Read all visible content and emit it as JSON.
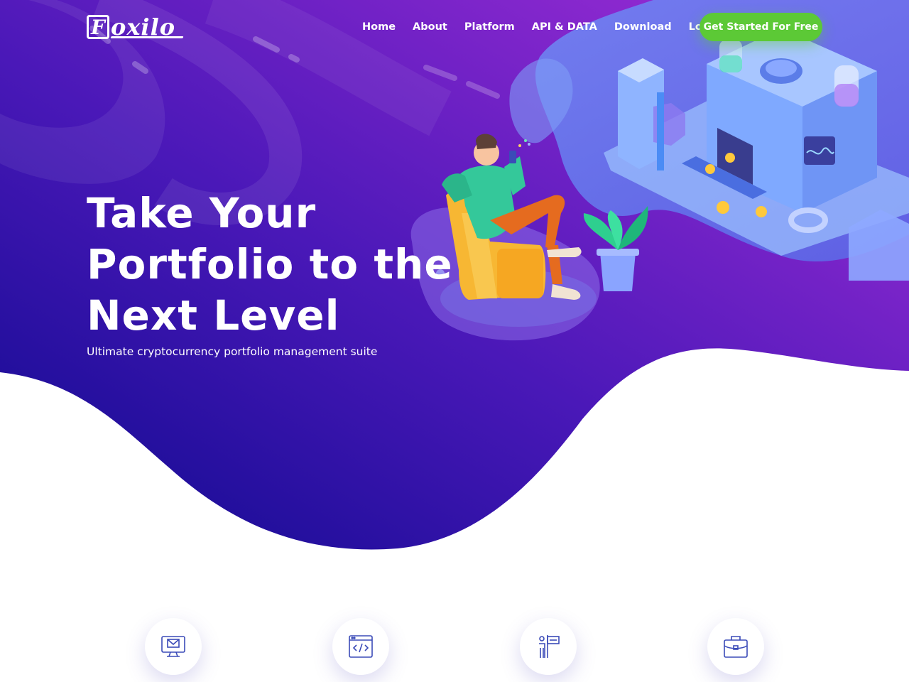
{
  "brand": {
    "logo_letter": "F",
    "logo_rest": "oxilo"
  },
  "nav": {
    "items": [
      {
        "label": "Home"
      },
      {
        "label": "About"
      },
      {
        "label": "Platform"
      },
      {
        "label": "API & DATA"
      },
      {
        "label": "Download"
      },
      {
        "label": "Login"
      }
    ],
    "cta_label": "Get Started For Free"
  },
  "hero": {
    "title_lines": [
      "Take Your",
      "Portfolio to the",
      "Next Level"
    ],
    "subtitle": "Ultimate cryptocurrency portfolio management suite"
  },
  "features": {
    "icons": [
      "monitor-mail-icon",
      "code-window-icon",
      "presenter-board-icon",
      "briefcase-icon"
    ]
  },
  "colors": {
    "hero_gradient_start": "#1a0a8a",
    "hero_gradient_end": "#9b2fd6",
    "accent_green": "#5cc936",
    "icon_blue": "#3b4bb8"
  }
}
